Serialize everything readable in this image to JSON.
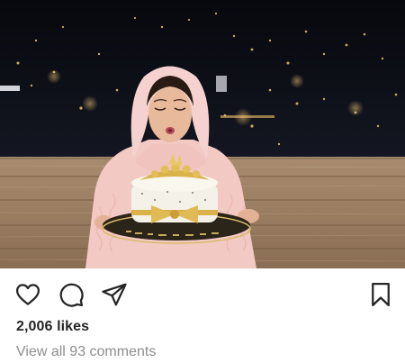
{
  "post": {
    "image_description_icon": "photo",
    "likes_text": "2,006 likes",
    "comments_link_text": "View all 93 comments"
  },
  "actions": {
    "like_icon": "heart-outline-icon",
    "comment_icon": "comment-bubble-icon",
    "share_icon": "paper-plane-icon",
    "save_icon": "bookmark-outline-icon"
  },
  "colors": {
    "text_primary": "#262626",
    "text_secondary": "#8e8e8e",
    "icon": "#262626"
  }
}
